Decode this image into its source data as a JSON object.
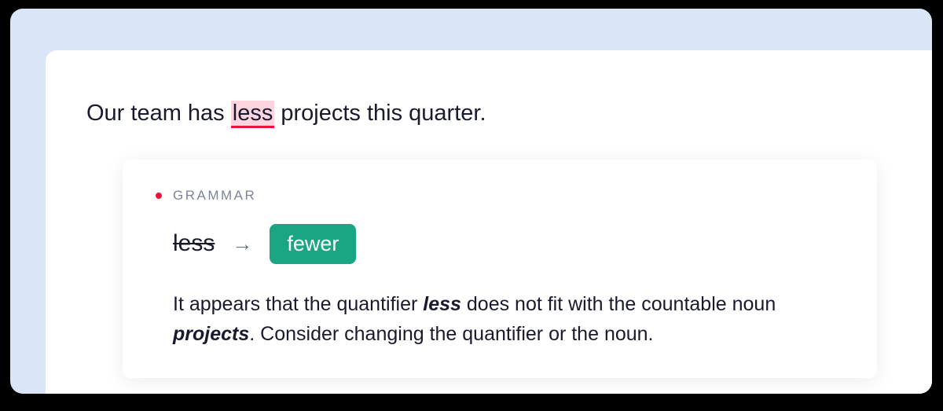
{
  "sentence": {
    "before": "Our team has ",
    "highlighted": "less",
    "after": " projects this quarter."
  },
  "suggestion": {
    "category": "GRAMMAR",
    "original_word": "less",
    "arrow": "→",
    "replacement": "fewer",
    "explanation": {
      "part1": "It appears that the quantifier ",
      "emphasis1": "less",
      "part2": " does not fit with the countable noun ",
      "emphasis2": "projects",
      "part3": ". Consider changing the quantifier or the noun."
    }
  },
  "colors": {
    "highlight_bg": "#fdd5de",
    "highlight_underline": "#e8143e",
    "pill_bg": "#1aa683",
    "outer_bg": "#dae5f7"
  }
}
